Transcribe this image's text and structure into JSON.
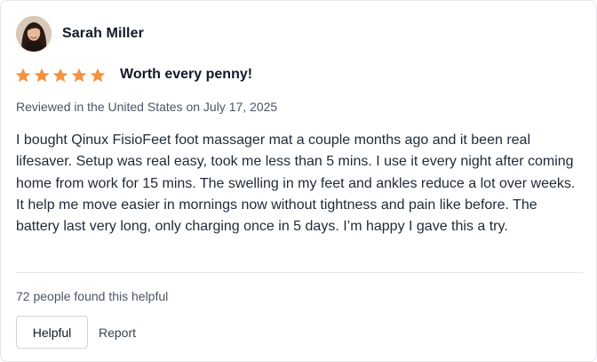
{
  "review": {
    "reviewer_name": "Sarah Miller",
    "rating": 5,
    "max_rating": 5,
    "star_color": "#f5923e",
    "headline": "Worth every penny!",
    "meta": "Reviewed in the United States on July 17, 2025",
    "body": "I bought Qinux FisioFeet foot massager mat a couple months ago and it been real lifesaver. Setup was real easy, took me less than 5 mins. I use it every night after coming home from work for 15 mins. The swelling in my feet and ankles reduce a lot over weeks. It help me move easier in mornings now without tightness and pain like before. The battery last very long, only charging once in 5 days. I’m happy I gave this a try.",
    "helpful_count_text": "72 people found this helpful"
  },
  "actions": {
    "helpful_label": "Helpful",
    "report_label": "Report"
  }
}
